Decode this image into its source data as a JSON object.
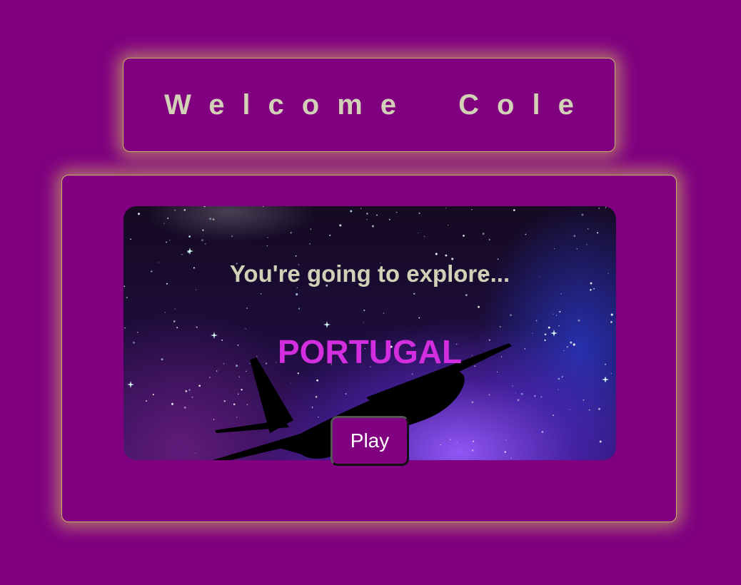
{
  "header": {
    "welcome_text": "Welcome Cole"
  },
  "game": {
    "intro_text": "You're going to explore...",
    "destination": "PORTUGAL",
    "play_label": "Play",
    "background_icon": "plane-icon"
  },
  "colors": {
    "page_background": "#800080",
    "glow": "#d6c460",
    "heading_text": "#d2d0b6",
    "destination_text": "#d22ee0",
    "button_text": "#ffffff"
  }
}
